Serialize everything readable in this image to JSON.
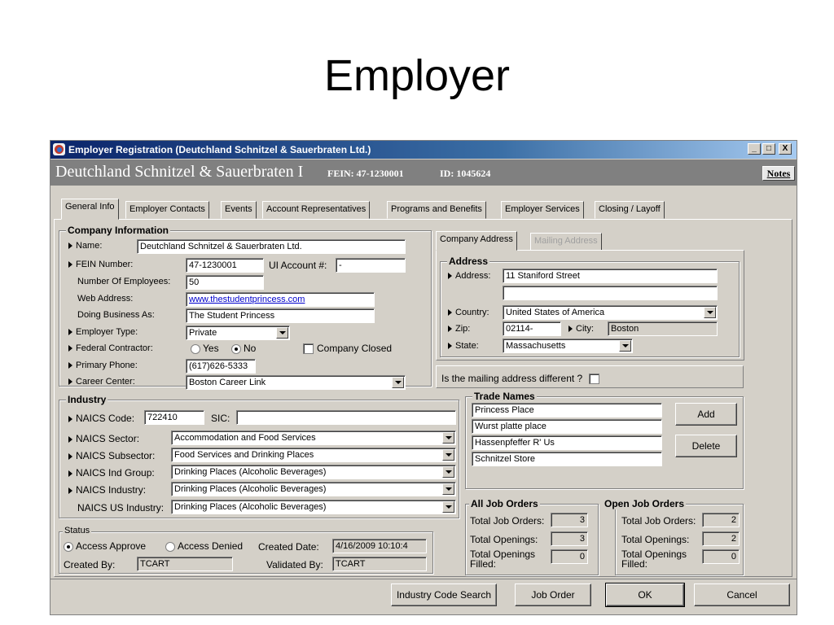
{
  "slide": {
    "title": "Employer"
  },
  "window": {
    "title": "Employer Registration (Deutchland Schnitzel & Sauerbraten Ltd.)",
    "controls": {
      "minimize": "_",
      "maximize": "□",
      "close": "X"
    }
  },
  "header": {
    "employer_name": "Deutchland Schnitzel & Sauerbraten I",
    "fein": "FEIN: 47-1230001",
    "id": "ID: 1045624",
    "notes_label": "Notes"
  },
  "tabs": [
    {
      "label": "General Info"
    },
    {
      "label": "Employer Contacts"
    },
    {
      "label": "Events"
    },
    {
      "label": "Account Representatives"
    },
    {
      "label": "Programs and Benefits"
    },
    {
      "label": "Employer Services"
    },
    {
      "label": "Closing / Layoff"
    }
  ],
  "company": {
    "group_title": "Company Information",
    "name_label": "Name:",
    "name_value": "Deutchland Schnitzel & Sauerbraten Ltd.",
    "fein_label": "FEIN Number:",
    "fein_value": "47-1230001",
    "ui_label": "UI Account #:",
    "ui_value": "-",
    "employees_label": "Number Of Employees:",
    "employees_value": "50",
    "web_label": "Web Address:",
    "web_value": "www.thestudentprincess.com",
    "dba_label": "Doing Business As:",
    "dba_value": "The Student Princess",
    "type_label": "Employer Type:",
    "type_value": "Private",
    "fed_label": "Federal Contractor:",
    "fed_yes": "Yes",
    "fed_no": "No",
    "closed_label": "Company Closed",
    "phone_label": "Primary Phone:",
    "phone_value": "(617)626-5333",
    "career_label": "Career Center:",
    "career_value": "Boston Career Link"
  },
  "address": {
    "tab_company": "Company Address",
    "tab_mailing": "Mailing Address",
    "group_title": "Address",
    "address_label": "Address:",
    "address_line1": "11 Staniford Street",
    "address_line2": "",
    "country_label": "Country:",
    "country_value": "United States of America",
    "zip_label": "Zip:",
    "zip_value": "02114-",
    "city_label": "City:",
    "city_value": "Boston",
    "state_label": "State:",
    "state_value": "Massachusetts",
    "mailing_diff_label": "Is the mailing address different ?"
  },
  "industry": {
    "group_title": "Industry",
    "naics_code_label": "NAICS Code:",
    "naics_code_value": "722410",
    "sic_label": "SIC:",
    "sic_value": "",
    "sector_label": "NAICS Sector:",
    "sector_value": "Accommodation and Food Services",
    "subsector_label": "NAICS Subsector:",
    "subsector_value": "Food Services and Drinking Places",
    "group_label": "NAICS Ind Group:",
    "group_value": "Drinking Places (Alcoholic Beverages)",
    "industry_label": "NAICS Industry:",
    "industry_value": "Drinking Places (Alcoholic Beverages)",
    "us_label": "NAICS US Industry:",
    "us_value": "Drinking Places (Alcoholic Beverages)"
  },
  "trade_names": {
    "group_title": "Trade Names",
    "items": [
      "Princess Place",
      "Wurst platte place",
      "Hassenpfeffer R' Us",
      "Schnitzel Store"
    ],
    "add_label": "Add",
    "delete_label": "Delete"
  },
  "status": {
    "group_title": "Status",
    "approve_label": "Access Approve",
    "denied_label": "Access Denied",
    "created_date_label": "Created Date:",
    "created_date_value": "4/16/2009 10:10:4",
    "created_by_label": "Created By:",
    "created_by_value": "TCART",
    "validated_by_label": "Validated By:",
    "validated_by_value": "TCART"
  },
  "jobs": {
    "all_title": "All Job Orders",
    "open_title": "Open Job Orders",
    "total_orders_label": "Total Job Orders:",
    "total_openings_label": "Total Openings:",
    "openings_filled_label": "Total Openings Filled:",
    "all_total_orders": "3",
    "all_total_openings": "3",
    "all_openings_filled": "0",
    "open_total_orders": "2",
    "open_total_openings": "2",
    "open_openings_filled": "0"
  },
  "buttons": {
    "industry_search": "Industry Code Search",
    "job_order": "Job Order",
    "ok": "OK",
    "cancel": "Cancel"
  }
}
